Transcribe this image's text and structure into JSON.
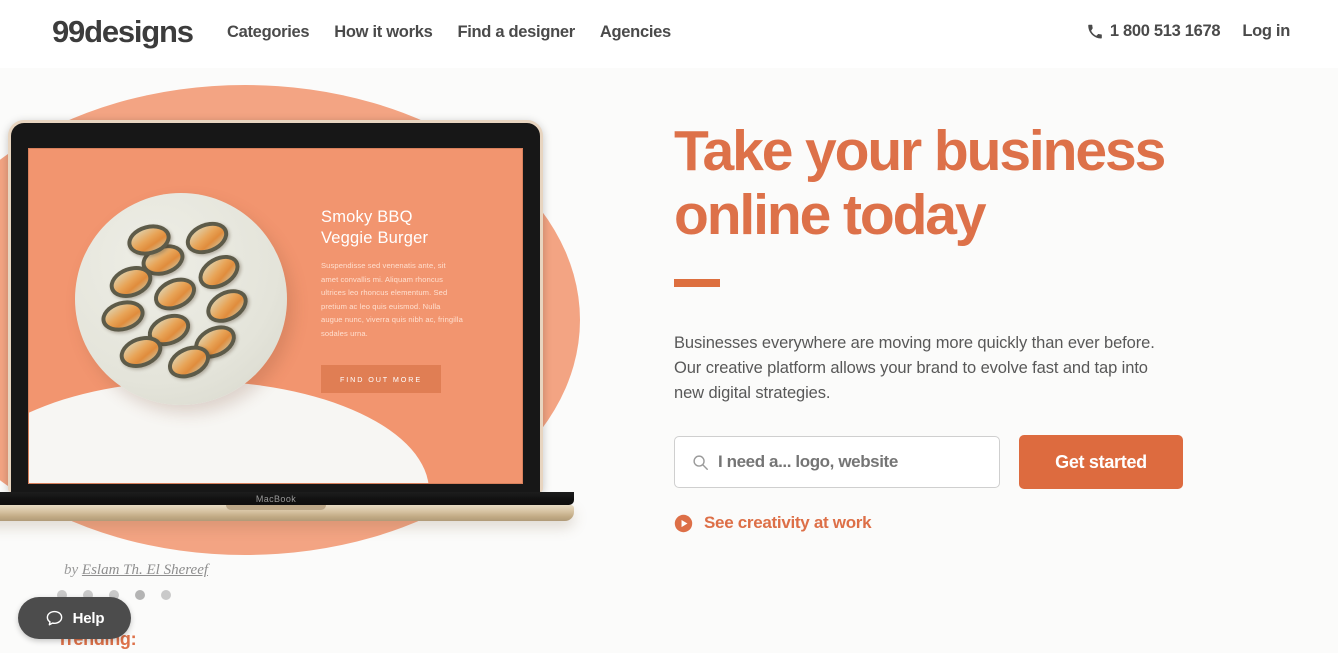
{
  "header": {
    "logo": "99designs",
    "nav": [
      {
        "label": "Categories"
      },
      {
        "label": "How it works"
      },
      {
        "label": "Find a designer"
      },
      {
        "label": "Agencies"
      }
    ],
    "phone": "1 800 513 1678",
    "phone_icon": "phone-icon",
    "login": "Log in"
  },
  "hero": {
    "headline_line1": "Take your business",
    "headline_line2": "online today",
    "subcopy": "Businesses everywhere are moving more quickly than ever before. Our creative platform allows your brand to evolve fast and tap into new digital strategies.",
    "search": {
      "placeholder": "I need a... logo, website",
      "value": "",
      "icon": "search-icon"
    },
    "cta_label": "Get started",
    "video_link": {
      "label": "See creativity at work",
      "icon": "play-circle-icon"
    }
  },
  "showcase": {
    "device_label": "MacBook",
    "screen": {
      "title_line1": "Smoky BBQ",
      "title_line2": "Veggie Burger",
      "body": "Suspendisse sed venenatis ante, sit amet convallis mi. Aliquam rhoncus ultrices leo rhoncus elementum. Sed pretium ac leo quis euismod. Nulla augue nunc, viverra quis nibh ac, fringilla sodales urna.",
      "button_label": "FIND OUT MORE"
    },
    "attribution_prefix": "by",
    "attribution_name": "Eslam Th. El Shereef",
    "carousel": {
      "count": 5,
      "active_index": 3
    }
  },
  "bottom": {
    "trending_label": "Trending:"
  },
  "help": {
    "label": "Help",
    "icon": "chat-bubble-icon"
  },
  "colors": {
    "brand_orange": "#dd6b3f",
    "headline_orange": "#dd7149",
    "screen_coral": "#f2956f",
    "blob_coral": "#f3a483",
    "text_dark": "#4a4a4a",
    "help_dark": "#4c4c4c"
  }
}
